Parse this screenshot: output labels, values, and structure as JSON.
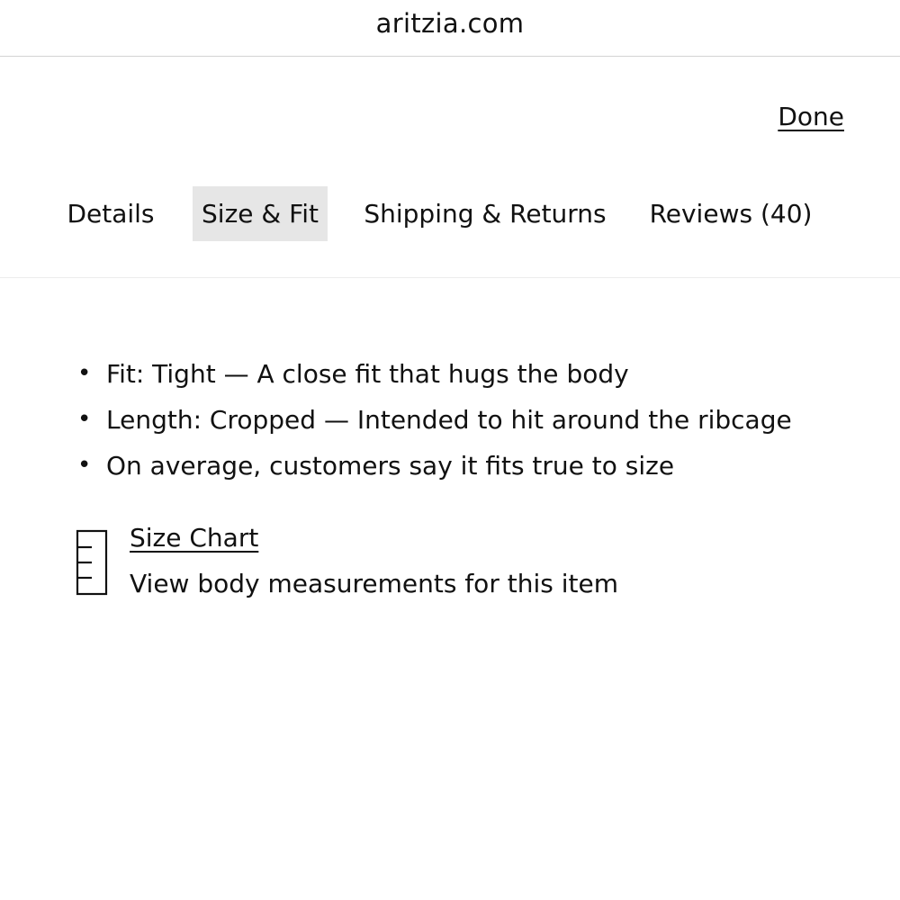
{
  "browser": {
    "url": "aritzia.com"
  },
  "header": {
    "done_label": "Done"
  },
  "tabs": [
    {
      "label": "Details",
      "active": false
    },
    {
      "label": "Size & Fit",
      "active": true
    },
    {
      "label": "Shipping & Returns",
      "active": false
    },
    {
      "label": "Reviews (40)",
      "active": false
    }
  ],
  "size_fit": {
    "items": [
      "Fit: Tight — A close fit that hugs the body",
      "Length: Cropped — Intended to hit around the ribcage",
      "On average, customers say it fits true to size"
    ],
    "bullet": "•",
    "size_chart": {
      "icon": "ruler-icon",
      "link_label": "Size Chart",
      "description": "View body measurements for this item"
    }
  },
  "colors": {
    "active_tab_bg": "#e6e6e6",
    "text": "#111111",
    "divider": "#d4d4d4"
  }
}
